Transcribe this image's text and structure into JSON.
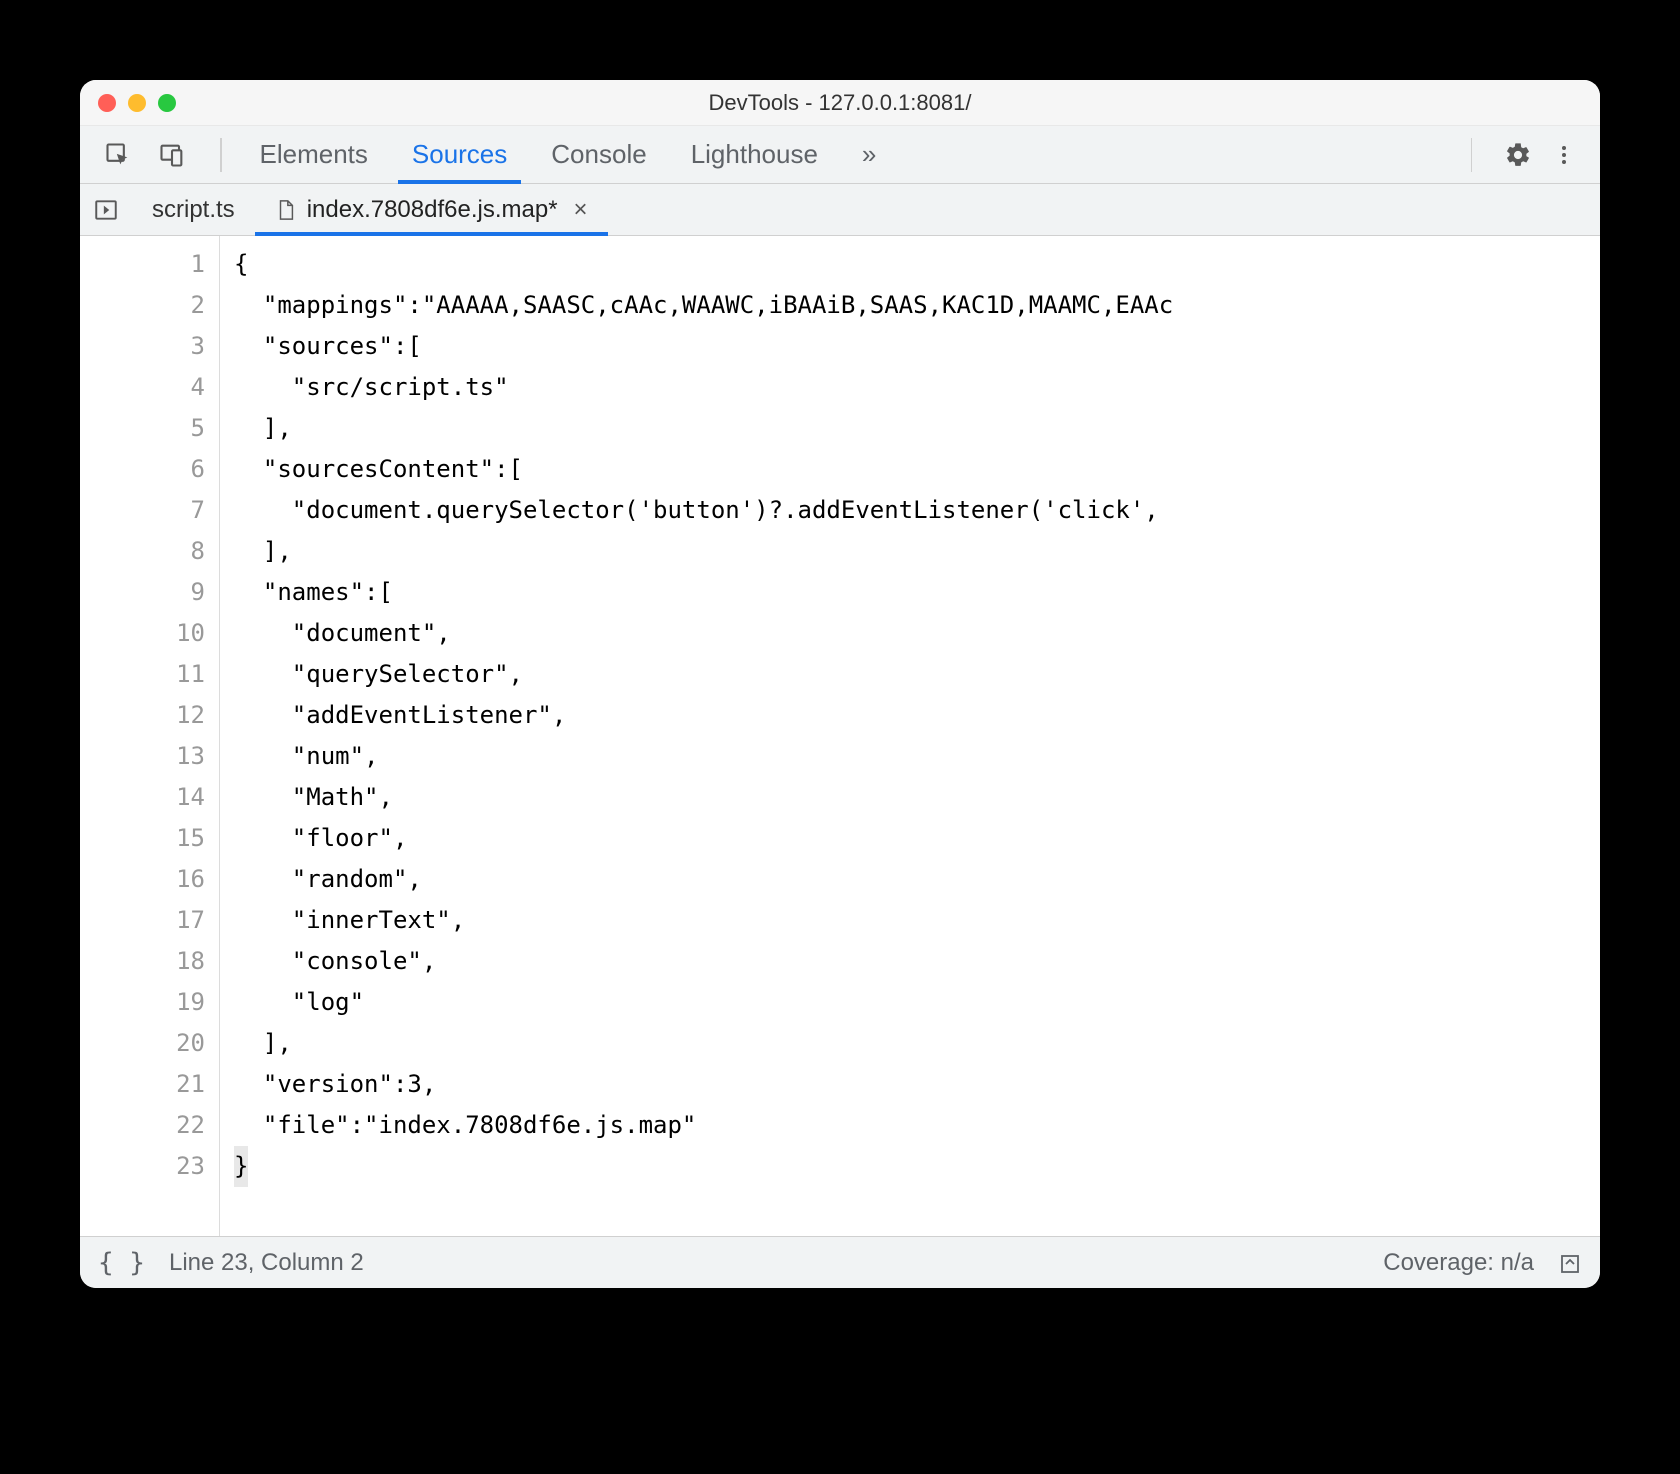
{
  "window": {
    "title": "DevTools - 127.0.0.1:8081/"
  },
  "toolbar": {
    "tabs": [
      "Elements",
      "Sources",
      "Console",
      "Lighthouse"
    ],
    "overflow_glyph": "»",
    "active_index": 1
  },
  "file_tabs": {
    "items": [
      {
        "label": "script.ts",
        "icon": "none",
        "active": false,
        "dirty": false,
        "closeable": false
      },
      {
        "label": "index.7808df6e.js.map*",
        "icon": "file",
        "active": true,
        "dirty": true,
        "closeable": true
      }
    ]
  },
  "code": {
    "lines": [
      "{",
      "  \"mappings\":\"AAAAA,SAASC,cAAc,WAAWC,iBAAiB,SAAS,KAC1D,MAAMC,EAAc",
      "  \"sources\":[",
      "    \"src/script.ts\"",
      "  ],",
      "  \"sourcesContent\":[",
      "    \"document.querySelector('button')?.addEventListener('click',",
      "  ],",
      "  \"names\":[",
      "    \"document\",",
      "    \"querySelector\",",
      "    \"addEventListener\",",
      "    \"num\",",
      "    \"Math\",",
      "    \"floor\",",
      "    \"random\",",
      "    \"innerText\",",
      "    \"console\",",
      "    \"log\"",
      "  ],",
      "  \"version\":3,",
      "  \"file\":\"index.7808df6e.js.map\"",
      "}"
    ]
  },
  "statusbar": {
    "cursor": "Line 23, Column 2",
    "coverage": "Coverage: n/a"
  }
}
